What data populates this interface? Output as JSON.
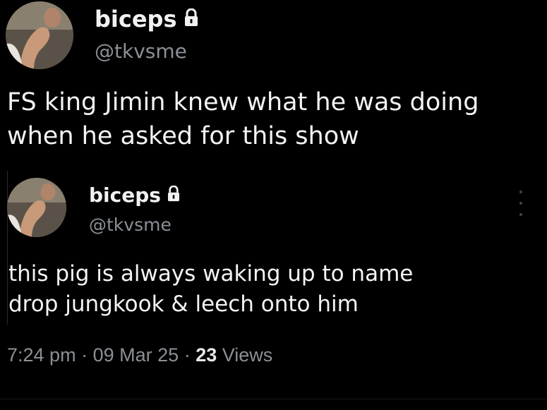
{
  "main_tweet": {
    "display_name": "biceps",
    "handle": "@tkvsme",
    "lock_icon": "lock-icon",
    "text_line1": "FS king Jimin knew what he was doing",
    "text_line2": "when he asked for this show"
  },
  "quoted_tweet": {
    "display_name": "biceps",
    "handle": "@tkvsme",
    "lock_icon": "lock-icon",
    "more_icon": "more-vertical-icon",
    "text_line1": "this pig is always waking up to name",
    "text_line2": "drop jungkook & leech onto him",
    "time": "7:24 pm",
    "separator": "·",
    "date": "09 Mar 25",
    "views_count": "23",
    "views_label": "Views"
  }
}
